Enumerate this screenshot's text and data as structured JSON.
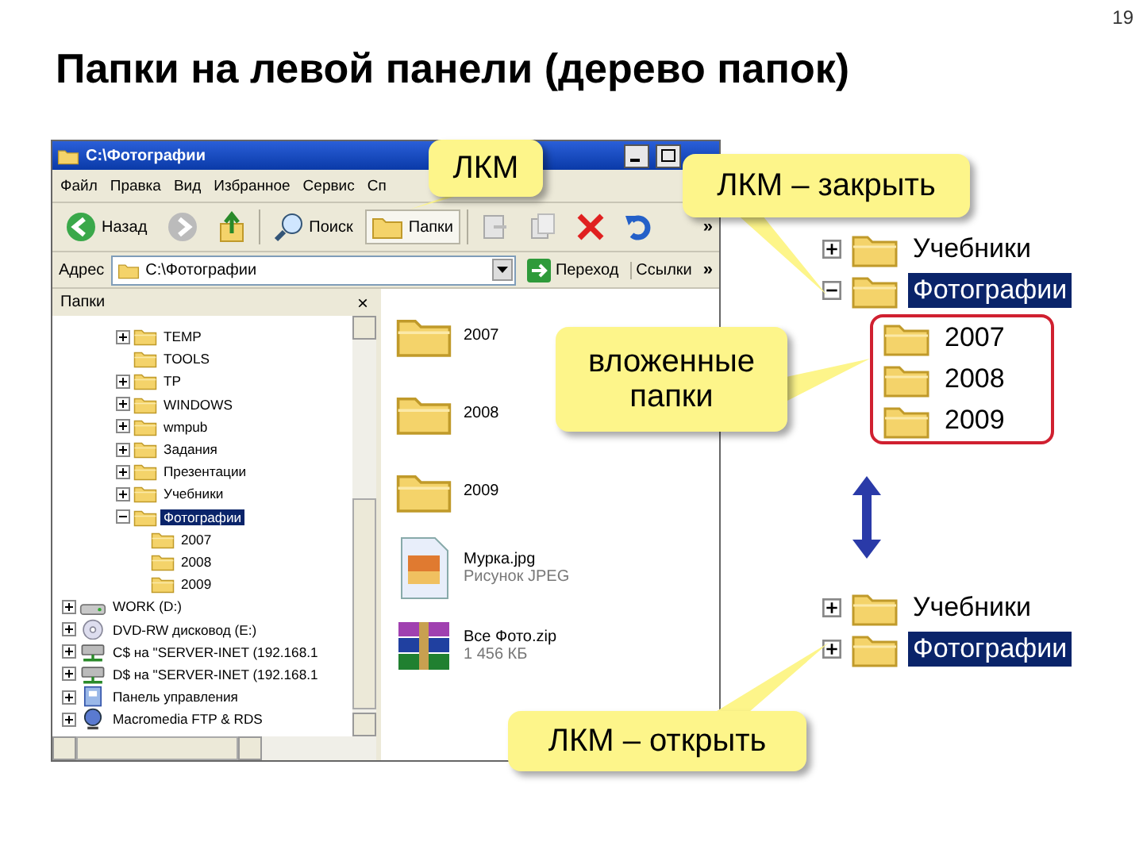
{
  "slide": {
    "title": "Папки на левой панели (дерево папок)",
    "page_number": "19"
  },
  "window": {
    "title": "C:\\Фотографии",
    "menu": [
      "Файл",
      "Правка",
      "Вид",
      "Избранное",
      "Сервис",
      "Сп"
    ],
    "toolbar": [
      {
        "kind": "back",
        "label": "Назад",
        "selected": false
      },
      {
        "kind": "forward",
        "selected": false
      },
      {
        "kind": "up",
        "selected": false
      },
      {
        "kind": "search",
        "label": "Поиск",
        "selected": false
      },
      {
        "kind": "folders",
        "label": "Папки",
        "selected": true
      },
      {
        "kind": "move",
        "selected": false
      },
      {
        "kind": "copy",
        "selected": false
      },
      {
        "kind": "delete",
        "selected": false
      },
      {
        "kind": "undo",
        "selected": false
      }
    ],
    "toolbar_more": "»",
    "address": {
      "label": "Адрес",
      "value": "C:\\Фотографии",
      "go": "Переход",
      "links": "Ссылки",
      "more": "»"
    },
    "folder_pane": {
      "title": "Папки",
      "close": "×",
      "inner_items": [
        {
          "label": "TEMP",
          "kind": "folder",
          "expanded": false
        },
        {
          "label": "TOOLS",
          "kind": "folder"
        },
        {
          "label": "TP",
          "kind": "folder",
          "expanded": false
        },
        {
          "label": "WINDOWS",
          "kind": "folder",
          "expanded": false
        },
        {
          "label": "wmpub",
          "kind": "folder",
          "expanded": false
        },
        {
          "label": "Задания",
          "kind": "folder",
          "expanded": false
        },
        {
          "label": "Презентации",
          "kind": "folder",
          "expanded": false
        },
        {
          "label": "Учебники",
          "kind": "folder",
          "expanded": false
        },
        {
          "label": "Фотографии",
          "kind": "folder",
          "expanded": true,
          "selected": true,
          "children": [
            {
              "label": "2007",
              "kind": "folder"
            },
            {
              "label": "2008",
              "kind": "folder"
            },
            {
              "label": "2009",
              "kind": "folder"
            }
          ]
        }
      ],
      "outer_items": [
        {
          "label": "WORK (D:)",
          "kind": "drive",
          "expanded": false
        },
        {
          "label": "DVD-RW дисковод (E:)",
          "kind": "dvd",
          "expanded": false
        },
        {
          "label": "C$ на \"SERVER-INET (192.168.1",
          "kind": "network",
          "expanded": false
        },
        {
          "label": "D$ на \"SERVER-INET (192.168.1",
          "kind": "network",
          "expanded": false
        },
        {
          "label": "Панель управления",
          "kind": "control-panel",
          "expanded": false
        },
        {
          "label": "Macromedia FTP & RDS",
          "kind": "ftp",
          "expanded": false
        }
      ]
    },
    "files": [
      {
        "name": "2007",
        "kind": "folder"
      },
      {
        "name": "2008",
        "kind": "folder"
      },
      {
        "name": "2009",
        "kind": "folder"
      },
      {
        "name": "Мурка.jpg",
        "detail": "Рисунок JPEG",
        "kind": "image"
      },
      {
        "name": "Все Фото.zip",
        "detail": "1 456 КБ",
        "kind": "archive"
      }
    ]
  },
  "tree_closed_example": [
    {
      "label": "Учебники",
      "expanded": false,
      "selected": false
    },
    {
      "label": "Фотографии",
      "expanded": true,
      "selected": true,
      "children": [
        {
          "label": "2007"
        },
        {
          "label": "2008"
        },
        {
          "label": "2009"
        }
      ]
    }
  ],
  "tree_open_example": [
    {
      "label": "Учебники",
      "expanded": false,
      "selected": false
    },
    {
      "label": "Фотографии",
      "expanded": false,
      "selected": true
    }
  ],
  "callouts": [
    {
      "kind": "folders",
      "text": "ЛКМ"
    },
    {
      "kind": "close",
      "text": "ЛКМ – закрыть"
    },
    {
      "kind": "nested",
      "text": "вложенные папки"
    },
    {
      "kind": "open",
      "text": "ЛКМ – открыть"
    }
  ]
}
